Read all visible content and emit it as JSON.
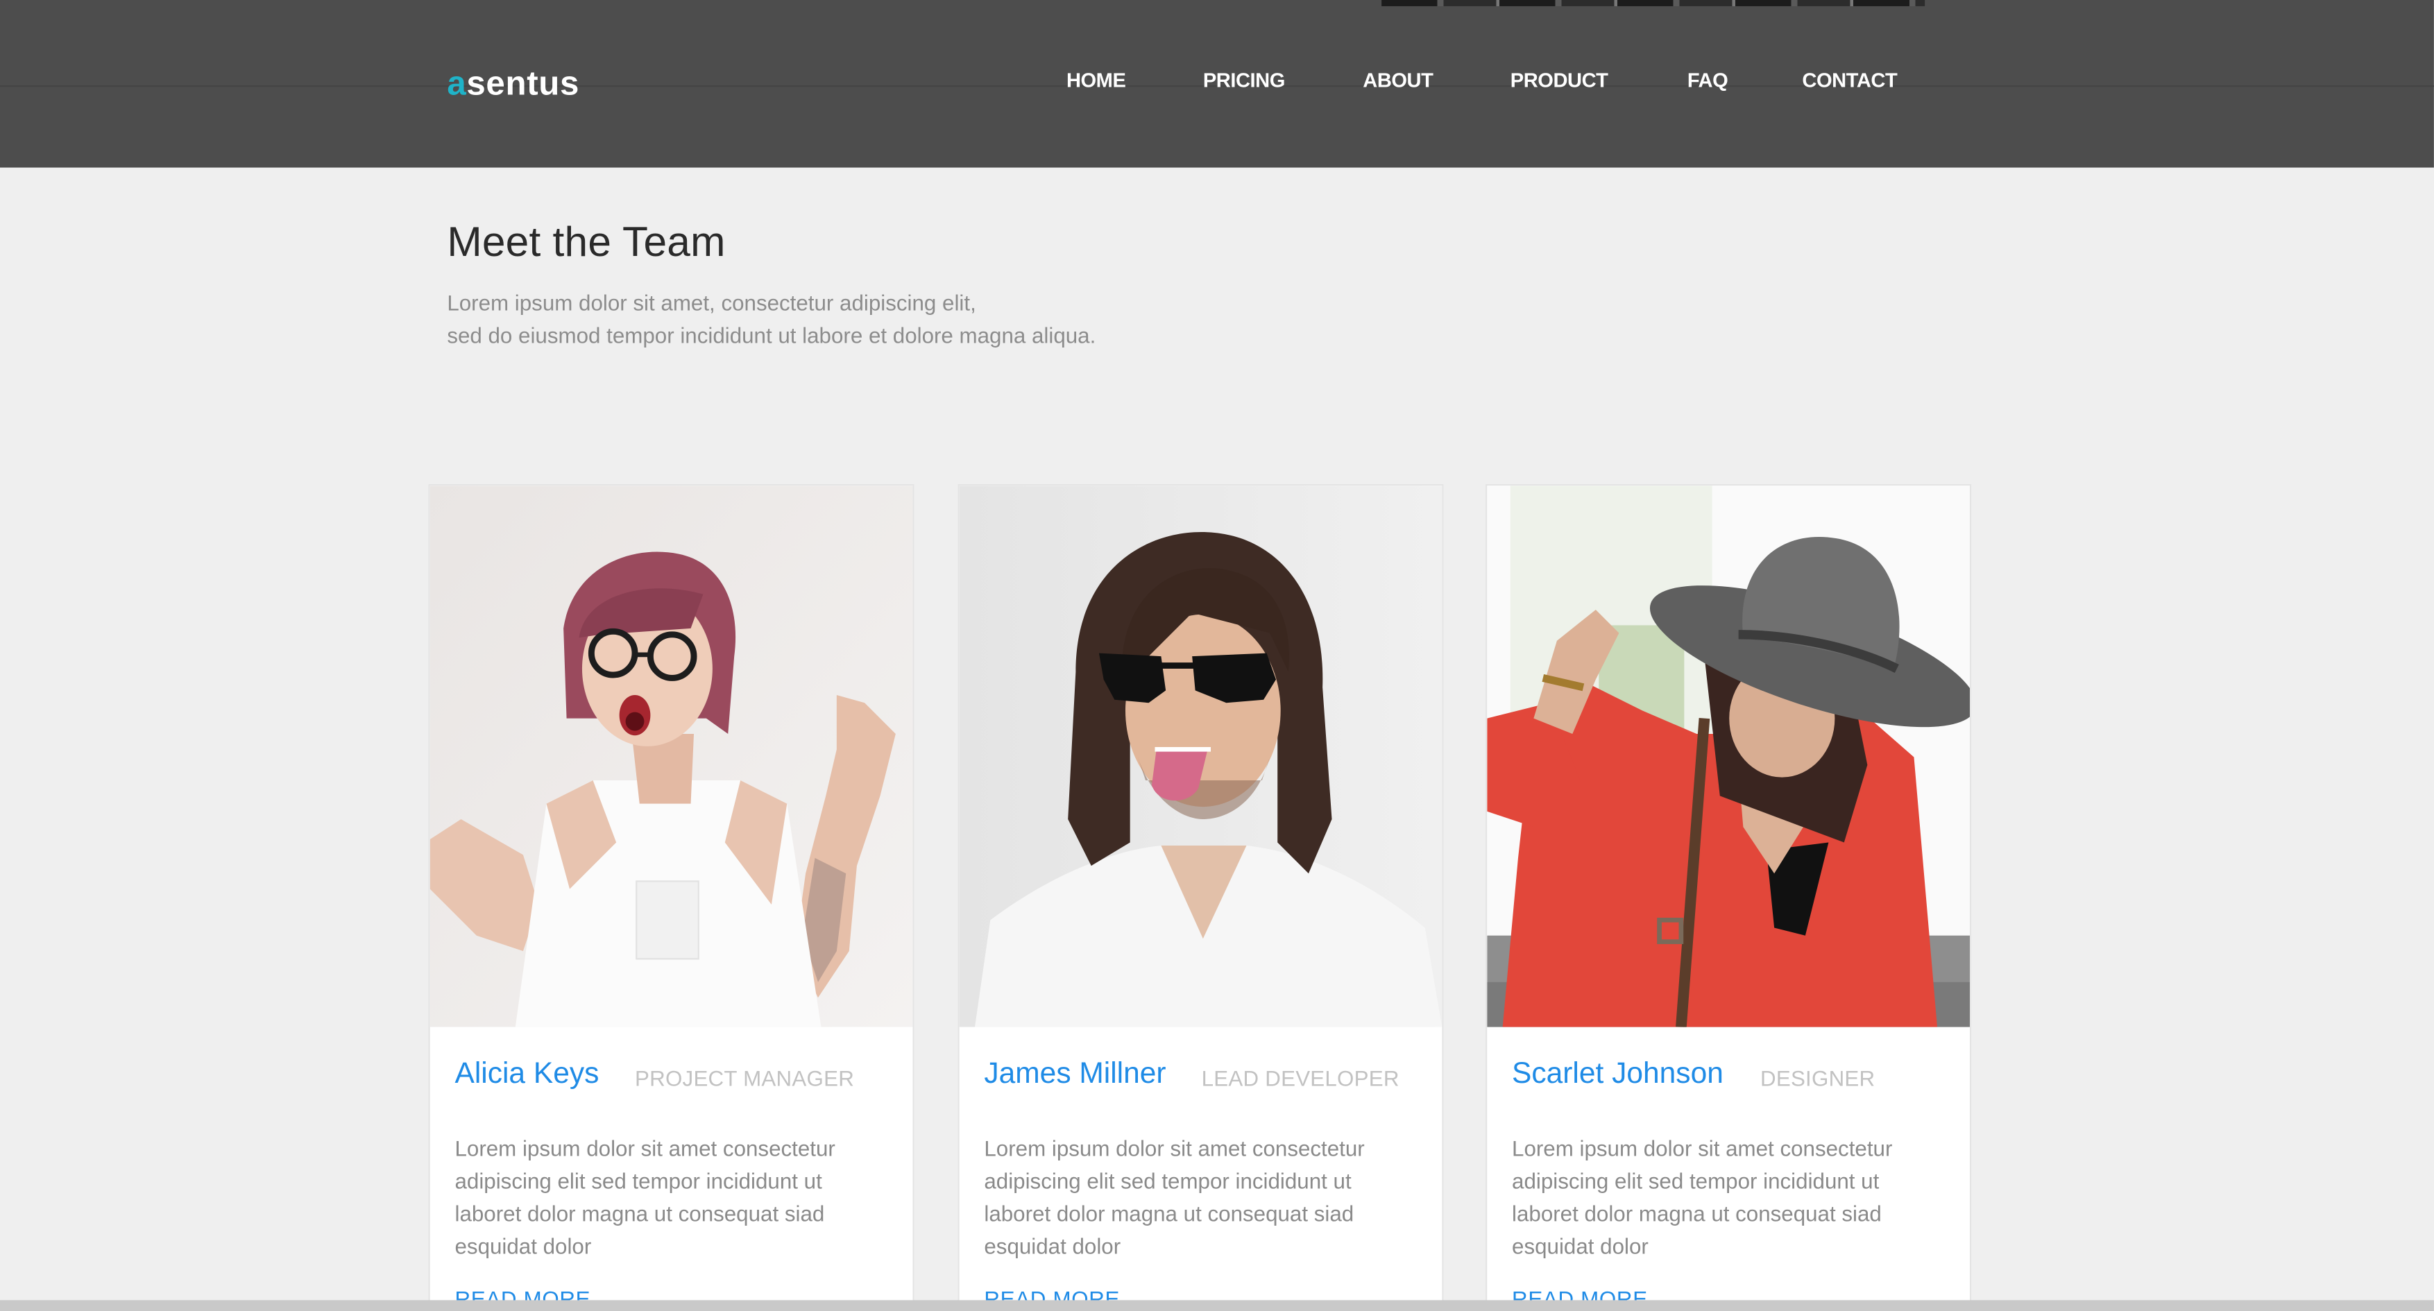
{
  "header": {
    "logo": {
      "accent": "a",
      "rest": "sentus"
    },
    "nav": [
      {
        "label": "HOME"
      },
      {
        "label": "PRICING"
      },
      {
        "label": "ABOUT"
      },
      {
        "label": "PRODUCT"
      },
      {
        "label": "FAQ"
      },
      {
        "label": "CONTACT"
      }
    ]
  },
  "intro": {
    "title": "Meet the Team",
    "subtitle_line1": "Lorem ipsum dolor sit amet, consectetur adipiscing elit,",
    "subtitle_line2": "sed do eiusmod tempor incididunt ut labore et dolore magna aliqua."
  },
  "team": [
    {
      "name": "Alicia Keys",
      "role": "PROJECT MANAGER",
      "bio": "Lorem ipsum dolor sit amet consectetur adipiscing elit sed tempor incididunt ut laboret dolor magna ut consequat siad esquidat dolor",
      "link": "READ MORE"
    },
    {
      "name": "James Millner",
      "role": "LEAD DEVELOPER",
      "bio": "Lorem ipsum dolor sit amet consectetur adipiscing elit sed tempor incididunt ut laboret dolor magna ut consequat siad esquidat dolor",
      "link": "READ MORE"
    },
    {
      "name": "Scarlet Johnson",
      "role": "DESIGNER",
      "bio": "Lorem ipsum dolor sit amet consectetur adipiscing elit sed tempor incididunt ut laboret dolor magna ut consequat siad esquidat dolor",
      "link": "READ MORE"
    }
  ],
  "colors": {
    "header_bg": "#4d4d4d",
    "logo_accent": "#1fb3c8",
    "link_blue": "#1f8be6",
    "page_bg": "#efefef"
  }
}
